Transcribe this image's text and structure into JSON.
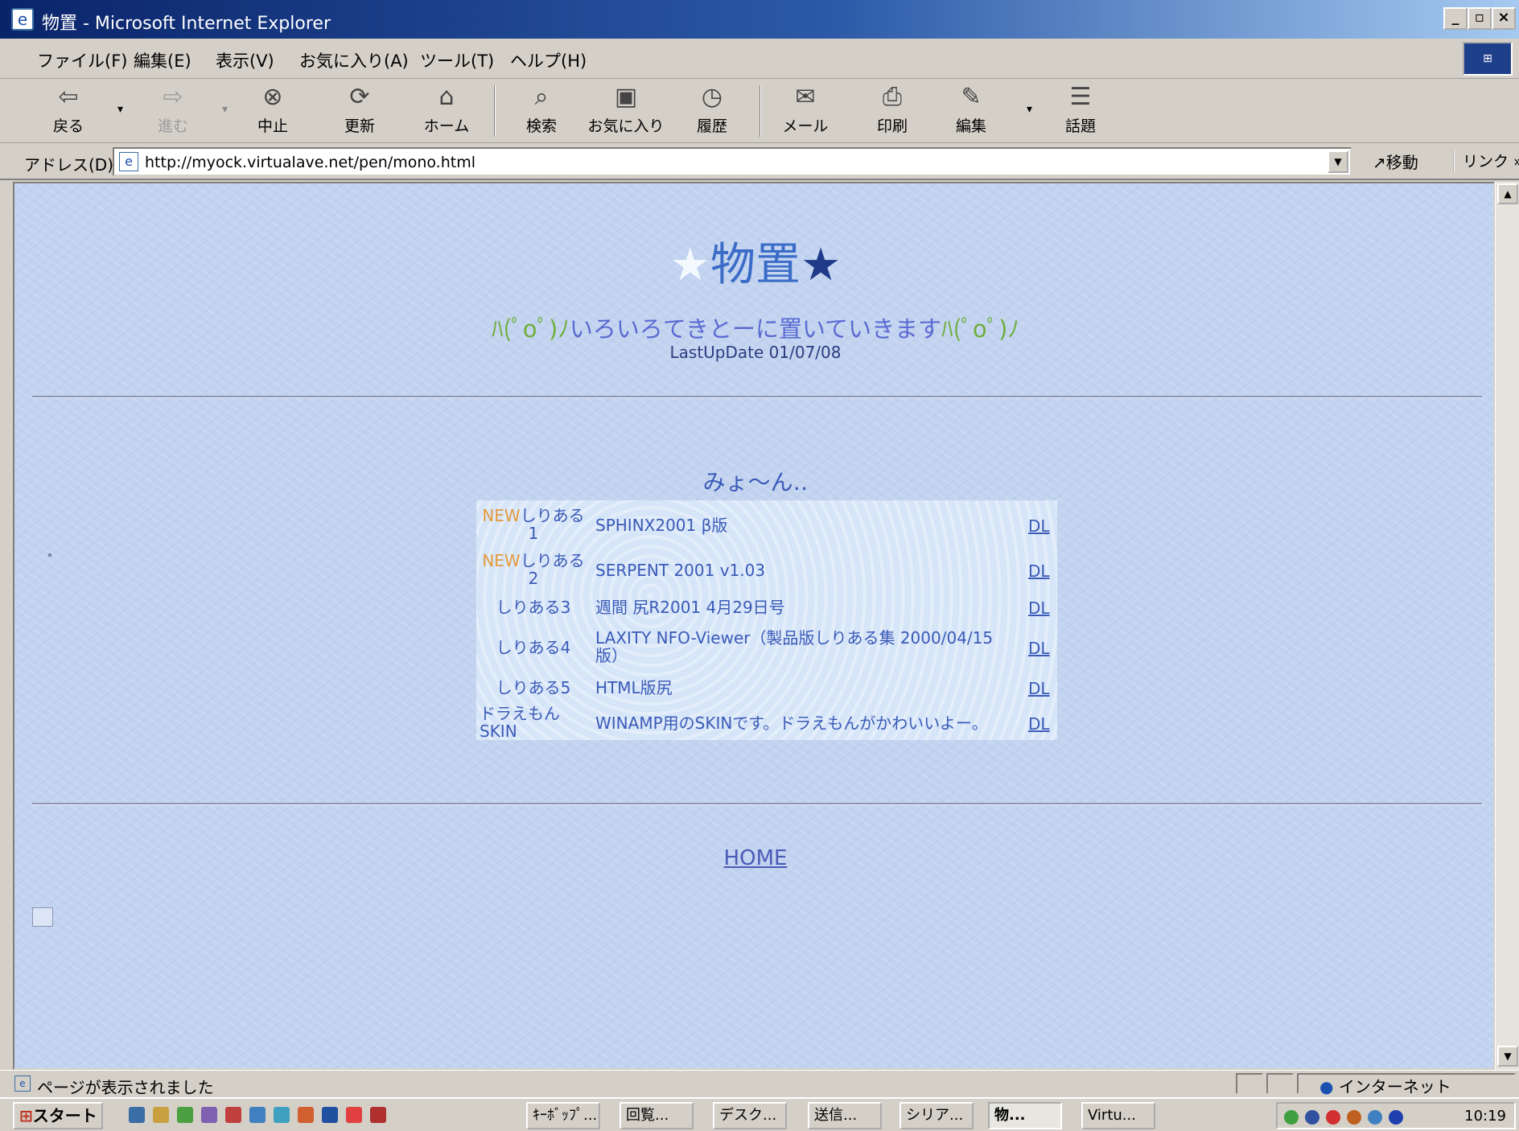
{
  "window": {
    "title": "物置 - Microsoft Internet Explorer",
    "controls": {
      "minimize": "_",
      "maximize": "▫",
      "close": "×"
    }
  },
  "menubar": {
    "items": [
      "ファイル(F)",
      "編集(E)",
      "表示(V)",
      "お気に入り(A)",
      "ツール(T)",
      "ヘルプ(H)"
    ]
  },
  "toolbar": {
    "back": "戻る",
    "forward": "進む",
    "stop": "中止",
    "refresh": "更新",
    "home": "ホーム",
    "search": "検索",
    "favorites": "お気に入り",
    "history": "履歴",
    "mail": "メール",
    "print": "印刷",
    "edit": "編集",
    "discuss": "話題"
  },
  "addressbar": {
    "label": "アドレス(D)",
    "url": "http://myock.virtualave.net/pen/mono.html",
    "go": "移動",
    "links": "リンク »"
  },
  "page": {
    "title_left_star": "★",
    "title_text": "物置",
    "title_right_star": "★",
    "tagline_kao_left": "ﾊ(ﾟoﾟ)ﾉ",
    "tagline_text": "いろいろてきとーに置いていきます",
    "tagline_kao_right": "ﾊ(ﾟoﾟ)ﾉ",
    "last_update": "LastUpDate 01/07/08",
    "section_heading": "みょ～ん‥",
    "downloads": [
      {
        "new": "NEW",
        "name": "しりある1",
        "desc": "SPHINX2001 β版",
        "link": "DL"
      },
      {
        "new": "NEW",
        "name": "しりある2",
        "desc": "SERPENT 2001 v1.03",
        "link": "DL"
      },
      {
        "new": "",
        "name": "しりある3",
        "desc": "週間 尻R2001 4月29日号",
        "link": "DL"
      },
      {
        "new": "",
        "name": "しりある4",
        "desc": "LAXITY NFO-Viewer（製品版しりある集 2000/04/15版）",
        "link": "DL"
      },
      {
        "new": "",
        "name": "しりある5",
        "desc": "HTML版尻",
        "link": "DL"
      },
      {
        "new": "",
        "name": "ドラえもんSKIN",
        "desc": "WINAMP用のSKINです。ドラえもんがかわいいよー。",
        "link": "DL"
      }
    ],
    "home_link": "HOME"
  },
  "statusbar": {
    "text": "ページが表示されました",
    "zone": "インターネット"
  },
  "taskbar": {
    "start": "スタート",
    "tasks": [
      "ｷｰﾎﾞｯﾌﾟ...",
      "回覧...",
      "デスク...",
      "送信...",
      "シリア...",
      "物...",
      "Virtu..."
    ],
    "clock": "10:19"
  },
  "colors": {
    "title_gradient_start": "#0a246a",
    "page_background": "#c2d3f0",
    "link_color": "#3a5ab8",
    "new_badge": "#e59a3c",
    "tagline_kao": "#6fae3c"
  }
}
